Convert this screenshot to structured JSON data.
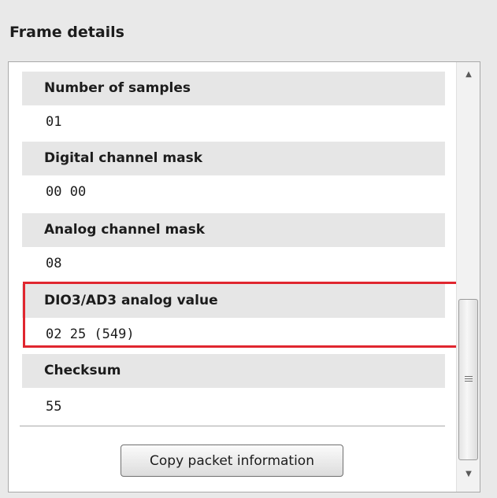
{
  "panel": {
    "title": "Frame details"
  },
  "fields": [
    {
      "label": "Number of samples",
      "value": "01"
    },
    {
      "label": "Digital channel mask",
      "value": "00 00"
    },
    {
      "label": "Analog channel mask",
      "value": "08"
    },
    {
      "label": "DIO3/AD3 analog value",
      "value": "02 25 (549)"
    },
    {
      "label": "Checksum",
      "value": "55"
    }
  ],
  "actions": {
    "copy_label": "Copy packet information"
  },
  "scrollbar": {
    "up_icon": "▲",
    "down_icon": "▼"
  },
  "colors": {
    "highlight": "#e0262f",
    "header_bg": "#e6e6e6"
  }
}
